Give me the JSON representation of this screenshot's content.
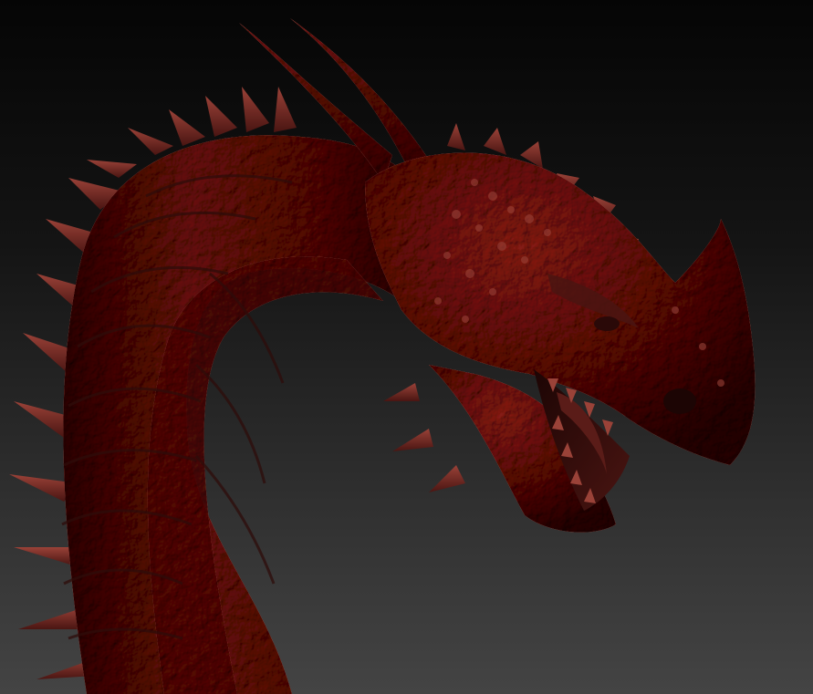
{
  "scene": {
    "subject": "dragon-sculpt",
    "colors": {
      "background_top": "#050505",
      "background_bottom": "#444444",
      "clay_base": "#7a2a24",
      "clay_highlight": "#b0544a",
      "clay_shadow": "#2e0c0a",
      "clay_mid": "#5a1c18"
    }
  }
}
